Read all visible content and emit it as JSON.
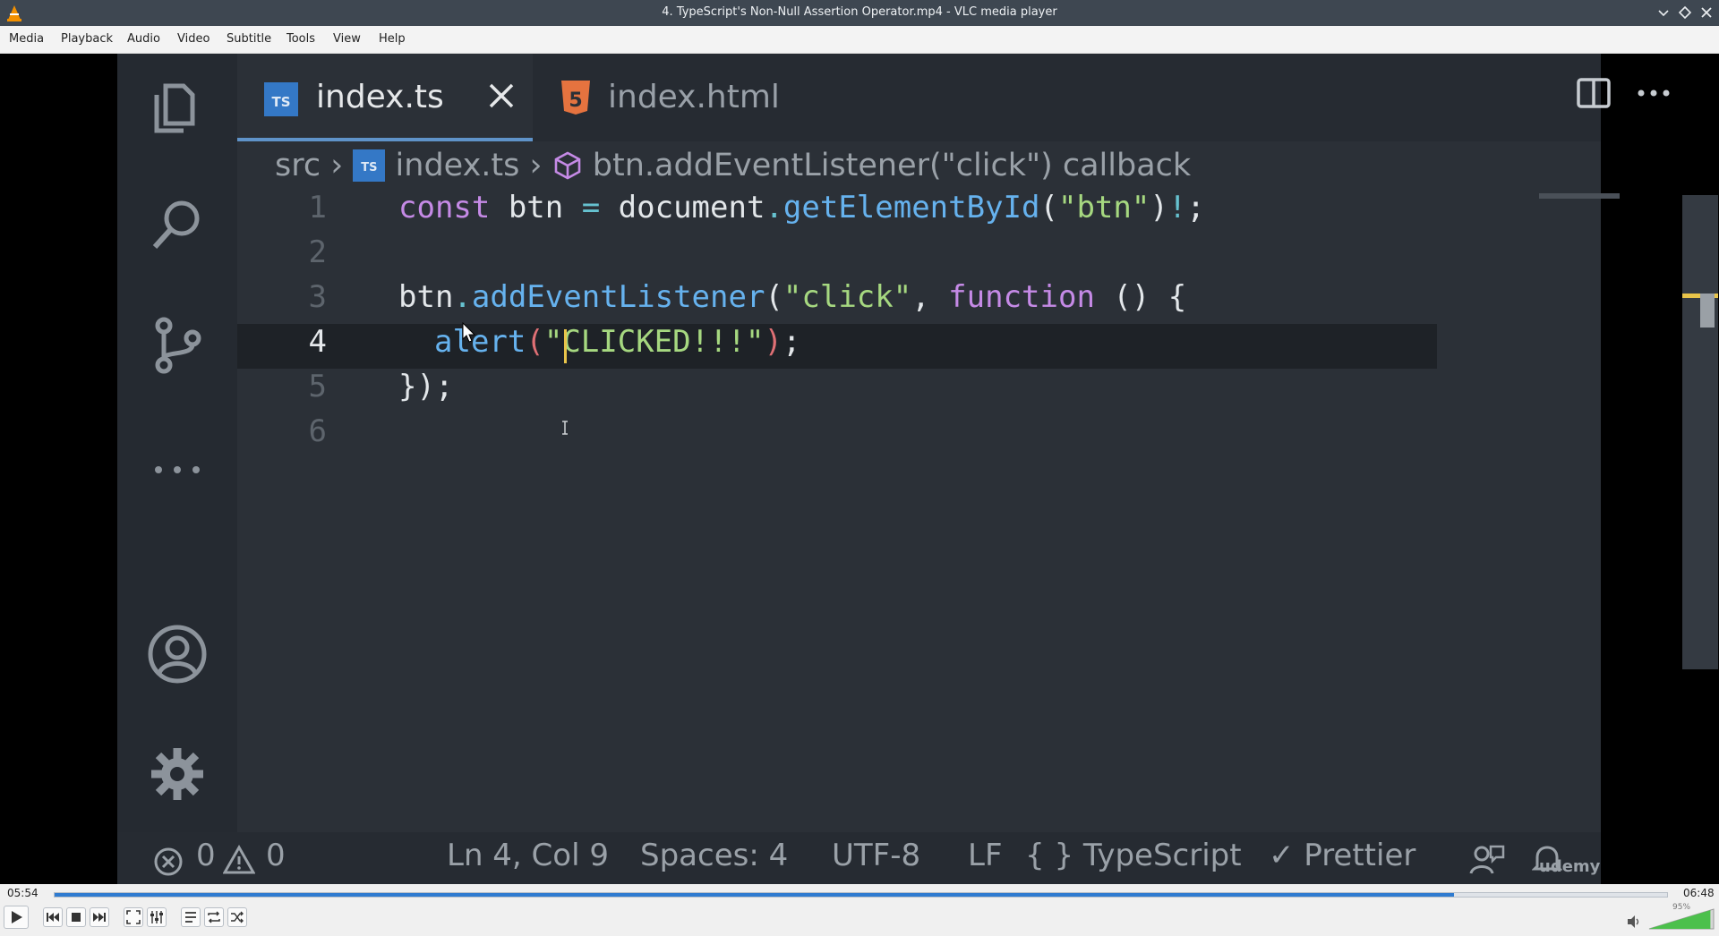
{
  "window": {
    "title": "4. TypeScript's Non-Null Assertion Operator.mp4 - VLC media player"
  },
  "menu": [
    "Media",
    "Playback",
    "Audio",
    "Video",
    "Subtitle",
    "Tools",
    "View",
    "Help"
  ],
  "editor": {
    "tabs": [
      {
        "label": "index.ts",
        "badge": "TS",
        "active": true
      },
      {
        "label": "index.html",
        "badge": "5",
        "active": false
      }
    ],
    "breadcrumb": {
      "folder": "src",
      "file": "index.ts",
      "symbol": "btn.addEventListener(\"click\") callback"
    },
    "line_numbers": [
      "1",
      "2",
      "3",
      "4",
      "5",
      "6"
    ],
    "current_line": "4",
    "status": {
      "errors": "0",
      "warnings": "0",
      "position": "Ln 4, Col 9",
      "spaces": "Spaces: 4",
      "encoding": "UTF-8",
      "eol": "LF",
      "language": "{ } TypeScript",
      "formatter": "✓ Prettier",
      "watermark": "udemy"
    }
  },
  "player": {
    "elapsed": "05:54",
    "total": "06:48",
    "progress": 0.868,
    "volume_label": "95%",
    "volume": 0.95
  },
  "colors": {
    "accent": "#2f7bd0",
    "keyword": "#c58ae6",
    "function": "#66b2ee",
    "string": "#a6d880"
  }
}
